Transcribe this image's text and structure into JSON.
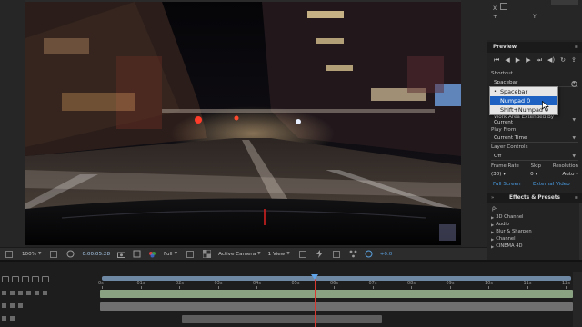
{
  "info": {
    "line1": "X",
    "line2": "+",
    "line3": "Y"
  },
  "viewer_toolbar": {
    "zoom": "100%",
    "timecode": "0:00:05:28",
    "resolution": "Full",
    "view": "Active Camera",
    "views_count": "1 View",
    "exposure": "+0.0"
  },
  "preview": {
    "tab_label": "Preview",
    "shortcut_label": "Shortcut",
    "shortcut_value": "Spacebar",
    "range_value": "Work Area Extended By Current",
    "play_from_label": "Play From",
    "play_from_value": "Current Time",
    "layer_controls_label": "Layer Controls",
    "layer_controls_value": "Off",
    "frame_rate_label": "Frame Rate",
    "skip_label": "Skip",
    "resolution_label": "Resolution",
    "frame_rate_value": "(30)",
    "skip_value": "0",
    "resolution_value": "Auto",
    "full_screen_label": "Full Screen",
    "external_video_label": "External Video"
  },
  "shortcut_popup": {
    "items": [
      "Spacebar",
      "Numpad 0",
      "Shift+Numpad 0"
    ],
    "checked_index": 0,
    "highlighted_index": 1,
    "highlight_color": "#1d62c2"
  },
  "effects": {
    "tab_label": "Effects & Presets",
    "search_placeholder": "ρ-",
    "items": [
      "3D Channel",
      "Audio",
      "Blur & Sharpen",
      "Channel",
      "CINEMA 4D"
    ]
  },
  "timeline": {
    "ticks": [
      "0s",
      "01s",
      "02s",
      "03s",
      "04s",
      "05s",
      "06s",
      "07s",
      "08s",
      "09s",
      "10s",
      "11s",
      "12s"
    ],
    "playhead_color": "#d8382f",
    "work_area_color": "#6e87a3",
    "layer_colors": [
      "#8aa282",
      "#6f6f6f",
      "#5d5d5d"
    ]
  },
  "colors": {
    "panel_bg": "#232323",
    "accent_blue": "#4a9ee6"
  }
}
